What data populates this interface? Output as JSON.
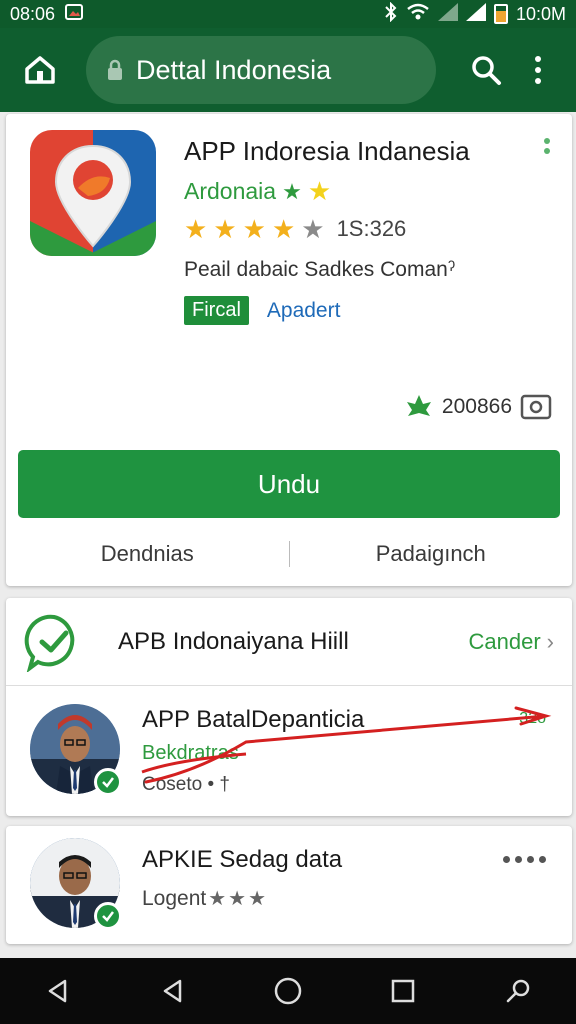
{
  "status_bar": {
    "time": "08:06",
    "clock_right": "10:0M",
    "icons": [
      "gallery-icon",
      "bluetooth-icon",
      "wifi-icon",
      "signal-icon",
      "signal-icon",
      "battery-icon"
    ]
  },
  "app_bar": {
    "url_text": "Dettal Indonesia",
    "icons": [
      "home-icon",
      "lock-icon",
      "search-icon",
      "more-vert-icon"
    ]
  },
  "app": {
    "title": "APP Indoresia Indanesia",
    "developer": "Ardonaia",
    "rating_stars": 4,
    "rating_count": "1S:326",
    "description": "Peail dabaic Sadkes Comanˀ",
    "badge": "Fircal",
    "link": "Apadert",
    "downloads": "200866",
    "install_label": "Undu",
    "actions": [
      "Dendnias",
      "Padaigınch"
    ]
  },
  "list": {
    "header_title": "APB Indonaiyana Hiill",
    "header_cta": "Cander",
    "item1": {
      "title": "APP BatalDepanticia",
      "subtitle": "Bekdratras",
      "meta": "Coseto • †",
      "corner": "32o"
    },
    "item2": {
      "title": "APKIE Sedag data",
      "subtitle": "Logent"
    }
  },
  "colors": {
    "primary_dark": "#0f5e2f",
    "primary": "#1f9340",
    "accent_green": "#2e9a3e",
    "link_blue": "#1e6ab8",
    "star": "#f3b01c",
    "scribble": "#d42020"
  },
  "nav_bar": {
    "icons": [
      "back-icon",
      "back-icon",
      "home-circle-icon",
      "recents-icon",
      "search-icon"
    ]
  }
}
